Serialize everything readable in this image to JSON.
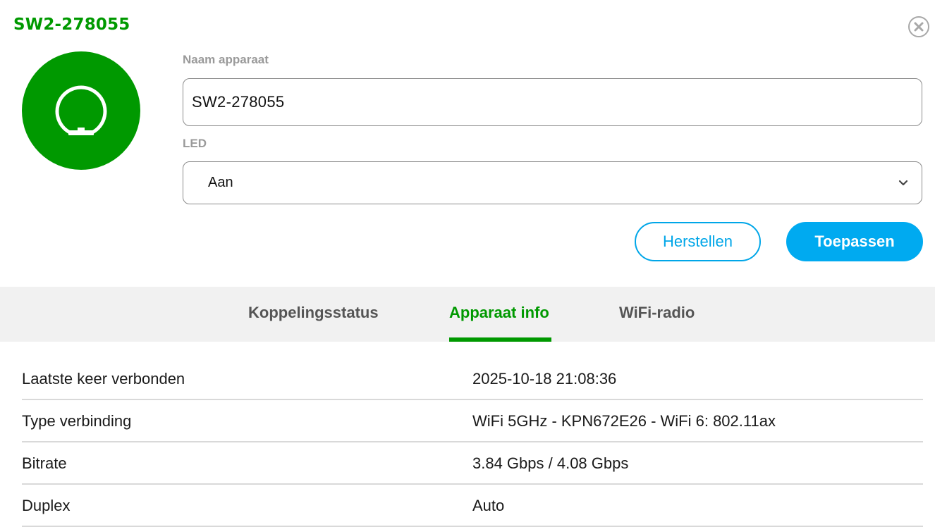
{
  "device": {
    "title": "SW2-278055",
    "icon": "wifi-extender-icon",
    "color": "#009900"
  },
  "form": {
    "name_label": "Naam apparaat",
    "name_value": "SW2-278055",
    "led_label": "LED",
    "led_value": "Aan"
  },
  "buttons": {
    "reset_label": "Herstellen",
    "apply_label": "Toepassen",
    "accent": "#00aaf0"
  },
  "tabs": [
    {
      "label": "Koppelingsstatus",
      "active": false
    },
    {
      "label": "Apparaat info",
      "active": true
    },
    {
      "label": "WiFi-radio",
      "active": false
    }
  ],
  "info": [
    {
      "key": "Laatste keer verbonden",
      "value": "2025-10-18 21:08:36"
    },
    {
      "key": "Type verbinding",
      "value": "WiFi 5GHz - KPN672E26 - WiFi 6: 802.11ax"
    },
    {
      "key": "Bitrate",
      "value": "3.84 Gbps / 4.08 Gbps"
    },
    {
      "key": "Duplex",
      "value": "Auto"
    }
  ]
}
